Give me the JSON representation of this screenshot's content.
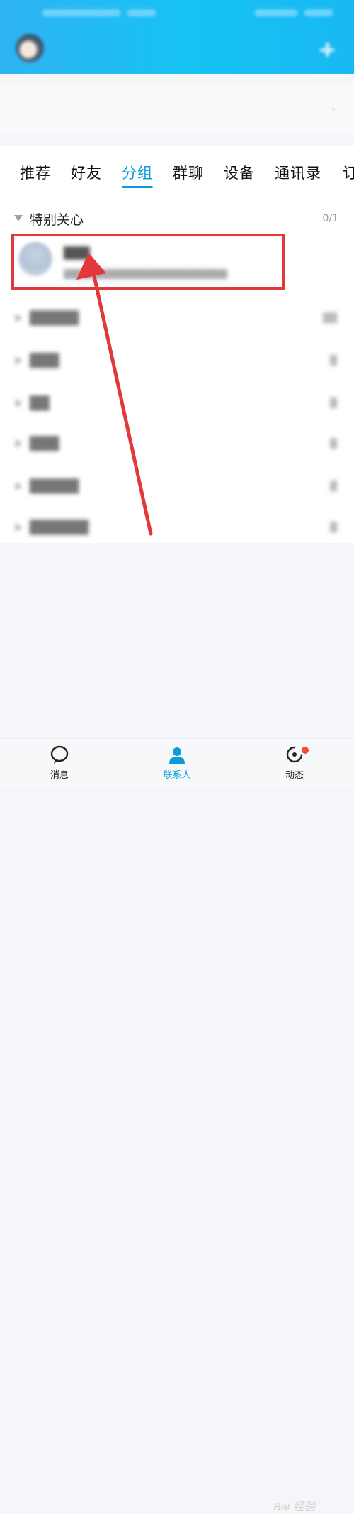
{
  "tabs": [
    {
      "label": "推荐"
    },
    {
      "label": "好友"
    },
    {
      "label": "分组"
    },
    {
      "label": "群聊"
    },
    {
      "label": "设备"
    },
    {
      "label": "通讯录"
    },
    {
      "label": "订"
    }
  ],
  "group": {
    "title": "特别关心",
    "count": "0/1"
  },
  "bottom_nav": {
    "messages_label": "消息",
    "contacts_label": "联系人",
    "dynamics_label": "动态"
  },
  "watermark": "Bai 经验",
  "colors": {
    "accent": "#0a9cdd",
    "highlight": "#e2383a",
    "header": "#16c3f5"
  }
}
